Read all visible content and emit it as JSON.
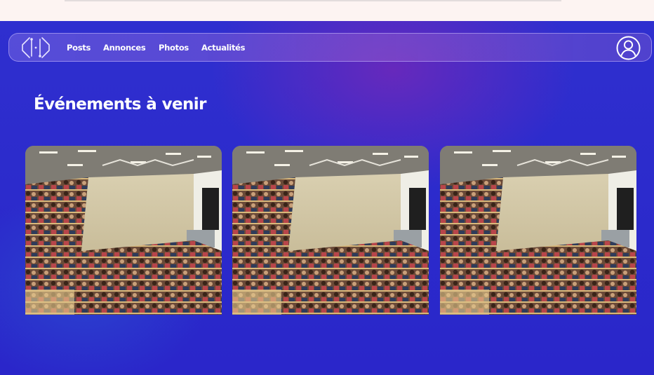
{
  "nav": {
    "links": [
      "Posts",
      "Annonces",
      "Photos",
      "Actualités"
    ],
    "logo_icon": "code-brackets-logo-icon",
    "profile_icon": "user-circle-icon"
  },
  "events": {
    "title": "Événements à venir",
    "cards": [
      {
        "image": "lecture-hall-photo"
      },
      {
        "image": "lecture-hall-photo"
      },
      {
        "image": "lecture-hall-photo"
      }
    ]
  },
  "colors": {
    "background": "#2a24cc",
    "top_strip": "#fdf4f2",
    "text": "#ffffff"
  }
}
